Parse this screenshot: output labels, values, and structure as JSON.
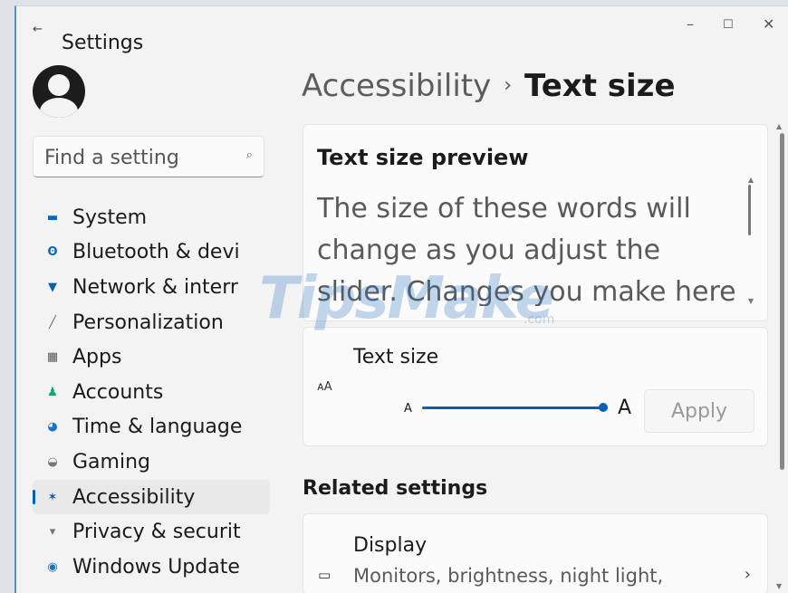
{
  "window": {
    "title": "Settings",
    "back_icon": "back-arrow-icon",
    "minimize_glyph": "–",
    "maximize_glyph": "☐",
    "close_glyph": "✕"
  },
  "search": {
    "placeholder": "Find a setting",
    "icon": "search-icon"
  },
  "sidebar": {
    "items": [
      {
        "label": "System",
        "icon": "system-icon",
        "color": "#0067c0"
      },
      {
        "label": "Bluetooth & devi",
        "icon": "bluetooth-icon",
        "color": "#0067c0"
      },
      {
        "label": "Network & interr",
        "icon": "network-icon",
        "color": "#0a5fb5"
      },
      {
        "label": "Personalization",
        "icon": "brush-icon",
        "color": "#6a6a6a"
      },
      {
        "label": "Apps",
        "icon": "apps-icon",
        "color": "#555555"
      },
      {
        "label": "Accounts",
        "icon": "accounts-icon",
        "color": "#1aa36a"
      },
      {
        "label": "Time & language",
        "icon": "globe-clock-icon",
        "color": "#1a73c9"
      },
      {
        "label": "Gaming",
        "icon": "gamepad-icon",
        "color": "#777777"
      },
      {
        "label": "Accessibility",
        "icon": "accessibility-icon",
        "color": "#0f5ba8",
        "active": true
      },
      {
        "label": "Privacy & securit",
        "icon": "shield-icon",
        "color": "#777777"
      },
      {
        "label": "Windows Update",
        "icon": "update-icon",
        "color": "#1a73c9"
      }
    ]
  },
  "breadcrumb": {
    "parent": "Accessibility",
    "separator": "›",
    "current": "Text size"
  },
  "preview": {
    "title": "Text size preview",
    "text": "The size of these words will change as you adjust the slider. Changes you make here will"
  },
  "text_size": {
    "label": "Text size",
    "aa_icon": "ᴀA",
    "small_a": "A",
    "big_a": "A",
    "slider_value": 1.0,
    "apply_label": "Apply"
  },
  "related": {
    "heading": "Related settings",
    "display": {
      "title": "Display",
      "subtitle": "Monitors, brightness, night light,",
      "icon": "monitor-icon"
    }
  },
  "watermark": {
    "text": "TipsMake",
    "domain": ".com"
  },
  "accent_color": "#005fb8"
}
